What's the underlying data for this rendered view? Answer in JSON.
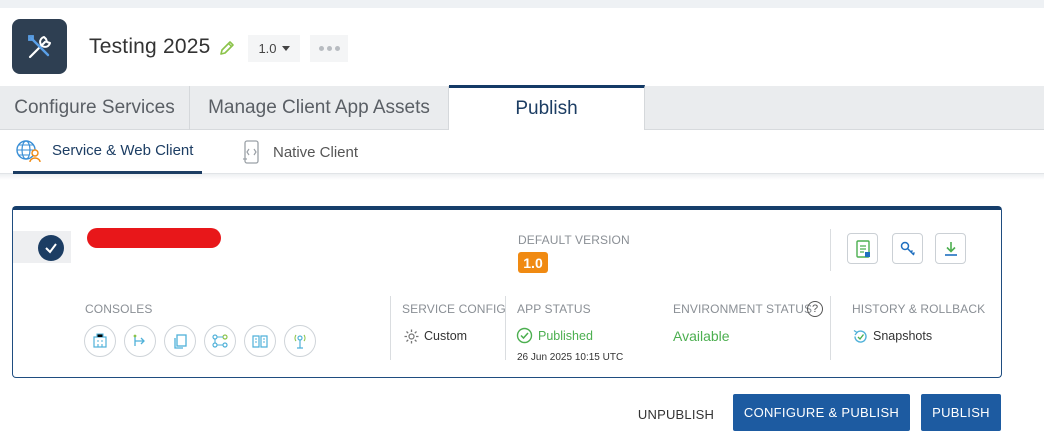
{
  "app": {
    "title": "Testing 2025",
    "version": "1.0",
    "logo_icon": "tools-icon"
  },
  "main_tabs": [
    {
      "label": "Configure Services",
      "active": false
    },
    {
      "label": "Manage Client App Assets",
      "active": false
    },
    {
      "label": "Publish",
      "active": true
    }
  ],
  "sub_tabs": [
    {
      "label": "Service & Web Client",
      "icon": "globe-user-icon",
      "active": true
    },
    {
      "label": "Native Client",
      "icon": "mobile-code-icon",
      "active": false
    }
  ],
  "card": {
    "default_version_label": "DEFAULT VERSION",
    "default_version": "1.0",
    "consoles_label": "CONSOLES",
    "service_config_label": "SERVICE CONFIG",
    "service_config_value": "Custom",
    "app_status_label": "APP STATUS",
    "app_status_value": "Published",
    "app_status_time": "26 Jun 2025 10:15 UTC",
    "environment_status_label": "ENVIRONMENT STATUS",
    "environment_status_help": "?",
    "environment_status_value": "Available",
    "history_label": "HISTORY & ROLLBACK",
    "history_value": "Snapshots"
  },
  "actions": {
    "unpublish": "UNPUBLISH",
    "configure_publish": "CONFIGURE & PUBLISH",
    "publish": "PUBLISH"
  },
  "colors": {
    "brand_dark": "#1c3d63",
    "primary_button": "#1d5ba1",
    "version_badge": "#f08a12",
    "status_green": "#4caf50"
  }
}
